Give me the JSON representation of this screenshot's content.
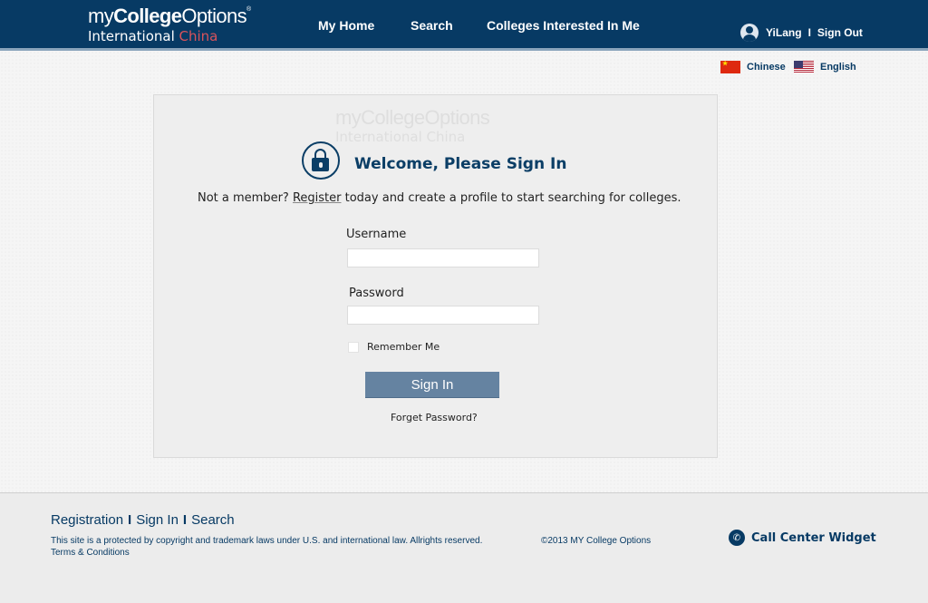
{
  "header": {
    "logo": {
      "line1_my": "my",
      "line1_college": "College",
      "line1_options": "Options",
      "line1_mark": "®",
      "line2_intl": "International ",
      "line2_china": "China"
    },
    "nav": {
      "home": "My Home",
      "search": "Search",
      "colleges": "Colleges Interested In Me"
    },
    "user": {
      "name": "YiLang",
      "separator": "I",
      "signout": "Sign Out"
    }
  },
  "language": {
    "chinese": "Chinese",
    "english": "English"
  },
  "login": {
    "watermark_line1": "myCollegeOptions",
    "watermark_line2": "International China",
    "title": "Welcome, Please Sign In",
    "intro_prefix": "Not a member? ",
    "intro_link": "Register",
    "intro_suffix": " today and create a profile to start searching for colleges.",
    "username_label": "Username",
    "username_value": "",
    "password_label": "Password",
    "password_value": "",
    "remember_label": "Remember Me",
    "signin_label": "Sign In",
    "forgot_label": "Forget Password?"
  },
  "footer": {
    "links": {
      "registration": "Registration",
      "signin": "Sign In",
      "search": "Search",
      "separator": "I"
    },
    "copyright": "This site is a protected by copyright and trademark laws under U.S. and international law. Allrights reserved.",
    "terms": "Terms & Conditions",
    "year": "©2013 MY College Options",
    "call": "Call Center Widget"
  },
  "colors": {
    "brand_navy": "#073a64",
    "accent_red": "#d9535b",
    "button": "#6583a1"
  },
  "icons": {
    "lock": "lock-icon",
    "user": "user-avatar-icon",
    "phone": "phone-icon",
    "flag_cn": "china-flag-icon",
    "flag_us": "us-flag-icon"
  }
}
